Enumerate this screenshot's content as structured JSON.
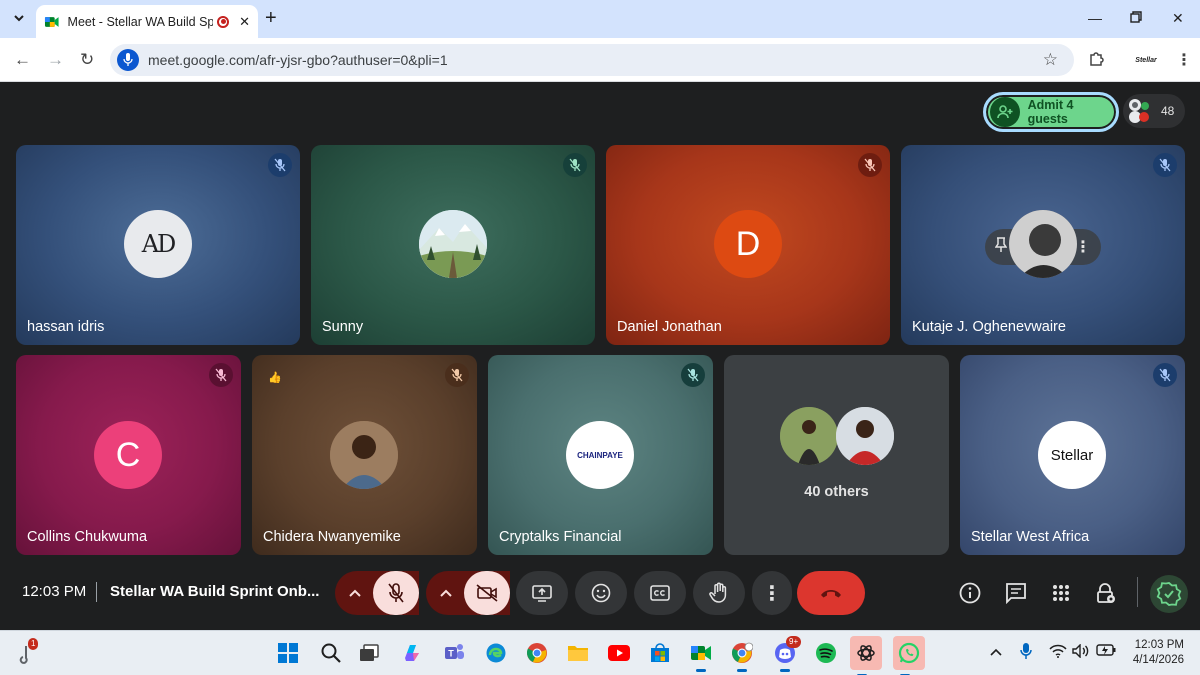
{
  "browser": {
    "tab_title": "Meet - Stellar WA Build Sprint",
    "url": "meet.google.com/afr-yjsr-gbo?authuser=0&pli=1",
    "profile_label": "Stellar"
  },
  "meet": {
    "admit_label": "Admit 4 guests",
    "participant_count": "48",
    "tiles": [
      {
        "name": "hassan idris",
        "avatar_text": "AD",
        "muted": true
      },
      {
        "name": "Sunny",
        "muted": true
      },
      {
        "name": "Daniel Jonathan",
        "avatar_letter": "D",
        "muted": true
      },
      {
        "name": "Kutaje J. Oghenevwaire",
        "muted": true
      },
      {
        "name": "Collins Chukwuma",
        "avatar_letter": "C",
        "muted": true
      },
      {
        "name": "Chidera Nwanyemike",
        "muted": true
      },
      {
        "name": "Cryptalks Financial",
        "avatar_text": "CHAINPAYE",
        "muted": true
      },
      {
        "name": "40 others"
      },
      {
        "name": "Stellar West Africa",
        "avatar_text": "Stellar",
        "muted": true
      }
    ],
    "time": "12:03 PM",
    "meeting_title": "Stellar WA Build Sprint Onb..."
  },
  "taskbar": {
    "time": "12:03 PM",
    "date": "4/14/2026",
    "weather_badge": "1",
    "discord_badge": "9+"
  },
  "colors": {
    "meet_bg": "#1e1f20",
    "admit_green": "#6dd58c",
    "end_call": "#dc362e",
    "tile_daniel": "#b2391d",
    "tile_collins": "#8e1c4e"
  }
}
